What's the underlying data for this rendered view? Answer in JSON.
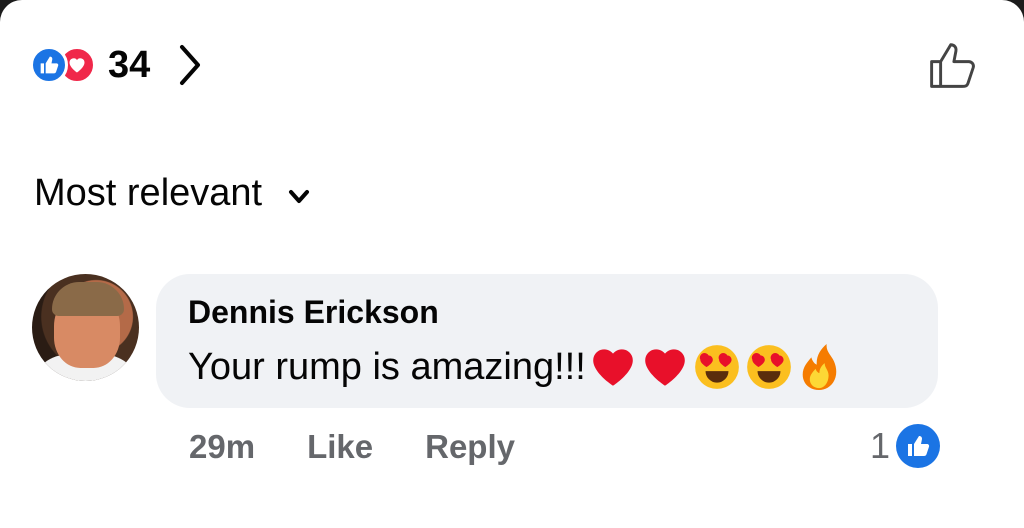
{
  "reactions": {
    "icons": [
      "like-icon",
      "love-icon"
    ],
    "count": "34",
    "colors": {
      "like": "#1b74e4",
      "love": "#f0284a"
    }
  },
  "sort": {
    "label": "Most relevant"
  },
  "comment": {
    "author": "Dennis Erickson",
    "text": "Your rump is amazing!!!",
    "emojis": [
      "red-heart-emoji",
      "red-heart-emoji",
      "heart-eyes-emoji",
      "heart-eyes-emoji",
      "fire-emoji"
    ],
    "time": "29m",
    "like_label": "Like",
    "reply_label": "Reply",
    "like_count": "1"
  }
}
